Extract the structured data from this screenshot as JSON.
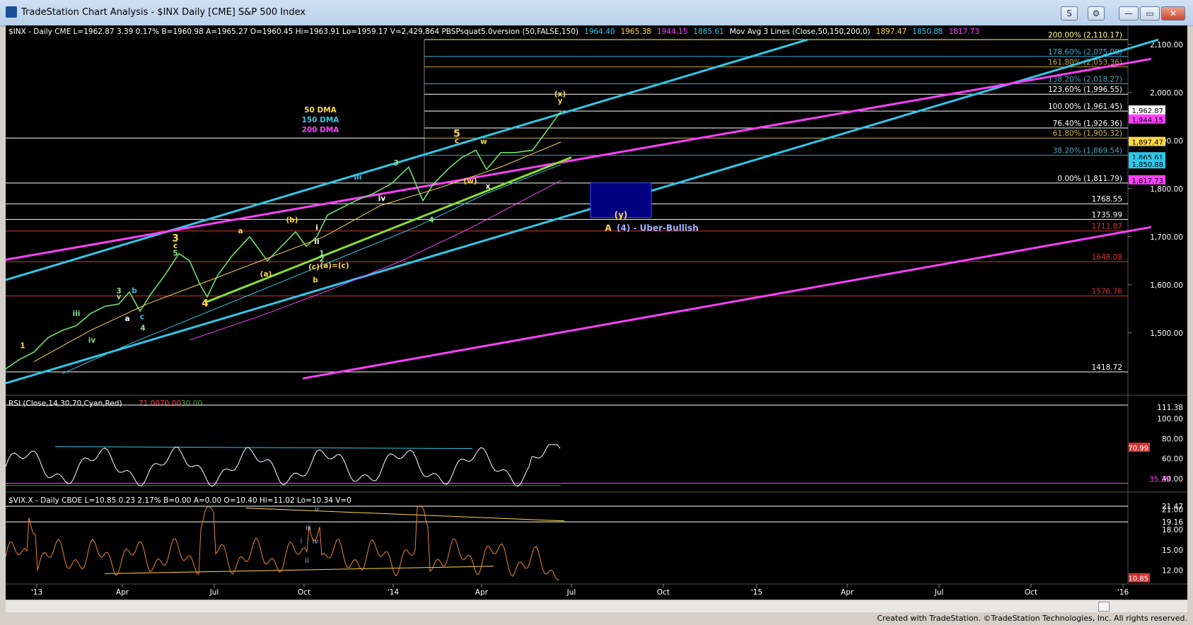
{
  "window": {
    "title": "TradeStation Chart Analysis - $INX Daily [CME] S&P 500 Index",
    "buttons": {
      "s": "S",
      "link": "⊞",
      "minimize": "—",
      "restore": "▭",
      "close": "✕",
      "toolbar_s": "S",
      "toolbar_gear": "⚙"
    }
  },
  "price_panel": {
    "header": [
      {
        "text": "$INX - Daily  CME  L=1962.87  3.39  0.17%  B=1960.98  A=1965.27  O=1960.45  Hi=1963.91  Lo=1959.17  V=2,429,864  PBSPsquat5.0version (50,FALSE,150)",
        "color": "#ffffff"
      },
      {
        "text": "1964.40",
        "color": "#31c7e8"
      },
      {
        "text": "1965.38",
        "color": "#ffd84a"
      },
      {
        "text": "1944.15",
        "color": "#ff40ff"
      },
      {
        "text": "1865.61",
        "color": "#31c7e8"
      },
      {
        "text": "Mov Avg 3 Lines (Close,50,150,200,0)",
        "color": "#ffffff"
      },
      {
        "text": "1897.47",
        "color": "#ffd84a"
      },
      {
        "text": "1850.88",
        "color": "#31c7e8"
      },
      {
        "text": "1817.73",
        "color": "#ff40ff"
      }
    ],
    "y_ticks": [
      "2,100.00",
      "2,000.00",
      "1,900.00",
      "1,800.00",
      "1,700.00",
      "1,600.00",
      "1,500.00"
    ],
    "fib_levels": [
      {
        "pct": "200.00% (2,110.17)",
        "value": 2110.17,
        "color": "#ffff80"
      },
      {
        "pct": "178.60% (2,075.08)",
        "value": 2075.08,
        "color": "#3aaed8"
      },
      {
        "pct": "161.80% (2,053.36)",
        "value": 2053.36,
        "color": "#c9a43a"
      },
      {
        "pct": "138.20% (2,018.27)",
        "value": 2018.27,
        "color": "#4aa0bf"
      },
      {
        "pct": "123.60% (1,996.55)",
        "value": 1996.55,
        "color": "#ffffff"
      },
      {
        "pct": "100.00% (1,961.45)",
        "value": 1961.45,
        "color": "#ffffff"
      },
      {
        "pct": "76.40% (1,926.36)",
        "value": 1926.36,
        "color": "#ffffff"
      },
      {
        "pct": "61.80% (1,905.32)",
        "value": 1905.32,
        "color": "#c9b44a"
      },
      {
        "pct": "38.20% (1,869.54)",
        "value": 1869.54,
        "color": "#4aa0bf"
      },
      {
        "pct": "0.00% (1,811.79)",
        "value": 1811.79,
        "color": "#ffffff"
      }
    ],
    "support_levels": [
      {
        "label": "1768.55",
        "value": 1768.55,
        "color": "#ffffff"
      },
      {
        "label": "1735.99",
        "value": 1735.99,
        "color": "#ffffff"
      },
      {
        "label": "1711.87",
        "value": 1711.87,
        "color": "#d23535"
      },
      {
        "label": "1648.08",
        "value": 1648.08,
        "color": "#d23535"
      },
      {
        "label": "1576.76",
        "value": 1576.76,
        "color": "#d23535"
      },
      {
        "label": "1418.72",
        "value": 1418.72,
        "color": "#ffffff"
      }
    ],
    "price_badges": [
      {
        "label": "1,962.87",
        "bg": "#ffffff",
        "fg": "#000000"
      },
      {
        "label": "1,944.15",
        "bg": "#ff40ff",
        "fg": "#000000"
      },
      {
        "label": "1,897.47",
        "bg": "#ffd84a",
        "fg": "#000000"
      },
      {
        "label": "1,865.61",
        "bg": "#31c7e8",
        "fg": "#000000"
      },
      {
        "label": "1,850.88",
        "bg": "#31c7e8",
        "fg": "#000000"
      },
      {
        "label": "1,817.73",
        "bg": "#ff40ff",
        "fg": "#000000"
      }
    ],
    "ma_legend": [
      {
        "text": "50 DMA",
        "color": "#ffd84a"
      },
      {
        "text": "150 DMA",
        "color": "#31c7e8"
      },
      {
        "text": "200 DMA",
        "color": "#ff40ff"
      }
    ],
    "target_box_label": "(y)",
    "target_caption_a": "A",
    "target_caption": "(4) - Uber-Bullish",
    "wave_labels": [
      {
        "t": "1",
        "c": "#ffd84a"
      },
      {
        "t": "iii",
        "c": "#8fe28f"
      },
      {
        "t": "iv",
        "c": "#8fe28f"
      },
      {
        "t": "3",
        "c": "#8fe28f"
      },
      {
        "t": "v",
        "c": "#8fe28f"
      },
      {
        "t": "b",
        "c": "#31c7e8"
      },
      {
        "t": "a",
        "c": "#ffffff"
      },
      {
        "t": "c",
        "c": "#31c7e8"
      },
      {
        "t": "4",
        "c": "#8fe28f"
      },
      {
        "t": "3",
        "c": "#ffd84a"
      },
      {
        "t": "c",
        "c": "#ffd84a"
      },
      {
        "t": "5",
        "c": "#8fe28f"
      },
      {
        "t": "4",
        "c": "#ffd84a"
      },
      {
        "t": "a",
        "c": "#ffd84a"
      },
      {
        "t": "(a)",
        "c": "#ffd84a"
      },
      {
        "t": "(b)",
        "c": "#ffd84a"
      },
      {
        "t": "i",
        "c": "#ffffff"
      },
      {
        "t": "ii",
        "c": "#ffffff"
      },
      {
        "t": "(c)",
        "c": "#ffd84a"
      },
      {
        "t": "(a)=(c)",
        "c": "#ffd84a"
      },
      {
        "t": "b",
        "c": "#ffd84a"
      },
      {
        "t": "1",
        "c": "#8fe28f"
      },
      {
        "t": "2",
        "c": "#8fe28f"
      },
      {
        "t": "iii",
        "c": "#31c7e8"
      },
      {
        "t": "iv",
        "c": "#ffffff"
      },
      {
        "t": "3",
        "c": "#8fe28f"
      },
      {
        "t": "4",
        "c": "#8fe28f"
      },
      {
        "t": "5",
        "c": "#ffd84a"
      },
      {
        "t": "c",
        "c": "#ffd84a"
      },
      {
        "t": "w",
        "c": "#ffd84a"
      },
      {
        "t": "(w)",
        "c": "#ffd84a"
      },
      {
        "t": "x",
        "c": "#ffffff"
      },
      {
        "t": "(x)",
        "c": "#ffd84a"
      },
      {
        "t": "y",
        "c": "#ffd84a"
      }
    ]
  },
  "rsi_panel": {
    "header_text": "RSI (Close,14,30,70,Cyan,Red)",
    "v1": "71.00",
    "v2": "70.00",
    "v3": "30.00",
    "y_ticks": [
      "111.38",
      "100.00",
      "80.00",
      "60.00",
      "40.00"
    ],
    "badge": "70.99",
    "level_label": "35.29"
  },
  "vix_panel": {
    "header_text": "$VIX.X - Daily  CBOE  L=10.85  0.23  2.17%  B=0.00  A=0.00  O=10.40  Hi=11.02  Lo=10.34  V=0",
    "y_ticks": [
      "21.47",
      "21.00",
      "19.16",
      "18.00",
      "15.00",
      "12.00"
    ],
    "badge": "10.85",
    "wave_labels": [
      "v",
      "iii",
      "i",
      "iv",
      "ii"
    ]
  },
  "x_axis": {
    "labels": [
      "'13",
      "Apr",
      "Jul",
      "Oct",
      "'14",
      "Apr",
      "Jul",
      "Oct",
      "'15",
      "Apr",
      "Jul",
      "Oct",
      "'16"
    ]
  },
  "footer": {
    "text": "Created with TradeStation. ©TradeStation Technologies, Inc. All rights reserved."
  },
  "colors": {
    "cyan": "#31c7e8",
    "magenta": "#ff40ff",
    "yellow": "#ffd84a",
    "green": "#88dd33",
    "candle": "#6ee06e",
    "vix": "#e8833a",
    "rsi": "#ffffff",
    "red": "#d23535"
  }
}
